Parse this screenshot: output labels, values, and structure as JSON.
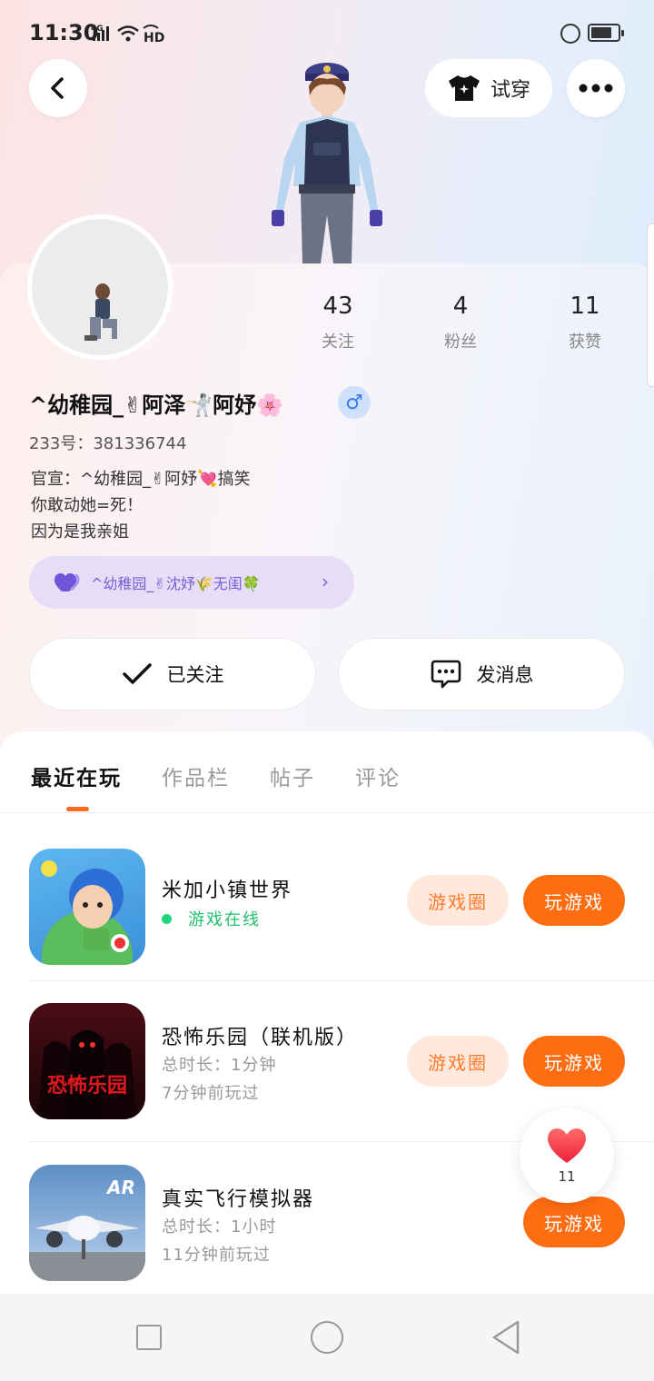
{
  "status_bar": {
    "time": "11:30",
    "network": "4G",
    "hd": "HD"
  },
  "header": {
    "try_on_label": "试穿"
  },
  "profile": {
    "stats": [
      {
        "value": "43",
        "label": "关注"
      },
      {
        "value": "4",
        "label": "粉丝"
      },
      {
        "value": "11",
        "label": "获赞"
      }
    ],
    "username": "^幼稚园_✌阿泽🤺阿妤🌸",
    "gender_symbol": "♂",
    "uid": "233号：381336744",
    "bio_lines": [
      "官宣：^幼稚园_✌阿妤💘搞笑",
      "你敢动她=死！",
      "因为是我亲姐"
    ],
    "group_label": "^幼稚园_✌沈妤🌾无闺🍀"
  },
  "actions": {
    "follow_label": "已关注",
    "message_label": "发消息"
  },
  "tabs": [
    {
      "label": "最近在玩",
      "active": true
    },
    {
      "label": "作品栏",
      "active": false
    },
    {
      "label": "帖子",
      "active": false
    },
    {
      "label": "评论",
      "active": false
    }
  ],
  "games": [
    {
      "title": "米加小镇世界",
      "status": "游戏在线",
      "circle_label": "游戏圈",
      "play_label": "玩游戏"
    },
    {
      "title": "恐怖乐园（联机版）",
      "duration": "总时长：1分钟",
      "last_played": "7分钟前玩过",
      "icon_text": "恐怖乐园",
      "circle_label": "游戏圈",
      "play_label": "玩游戏"
    },
    {
      "title": "真实飞行模拟器",
      "duration": "总时长：1小时",
      "last_played": "11分钟前玩过",
      "icon_text": "AR",
      "play_label": "玩游戏"
    }
  ],
  "like_float": {
    "count": "11"
  },
  "colors": {
    "accent": "#ff6d12",
    "accent_soft": "#ffe9dd",
    "online": "#1fbf6b",
    "group_bg": "#e6def6",
    "group_text": "#7a5cd6"
  },
  "icons": {
    "back": "chevron-left-icon",
    "try_on": "tshirt-icon",
    "more": "more-dots-icon",
    "follow": "check-icon",
    "message": "chat-bubble-icon",
    "group": "heart-icon",
    "like": "heart-icon"
  }
}
